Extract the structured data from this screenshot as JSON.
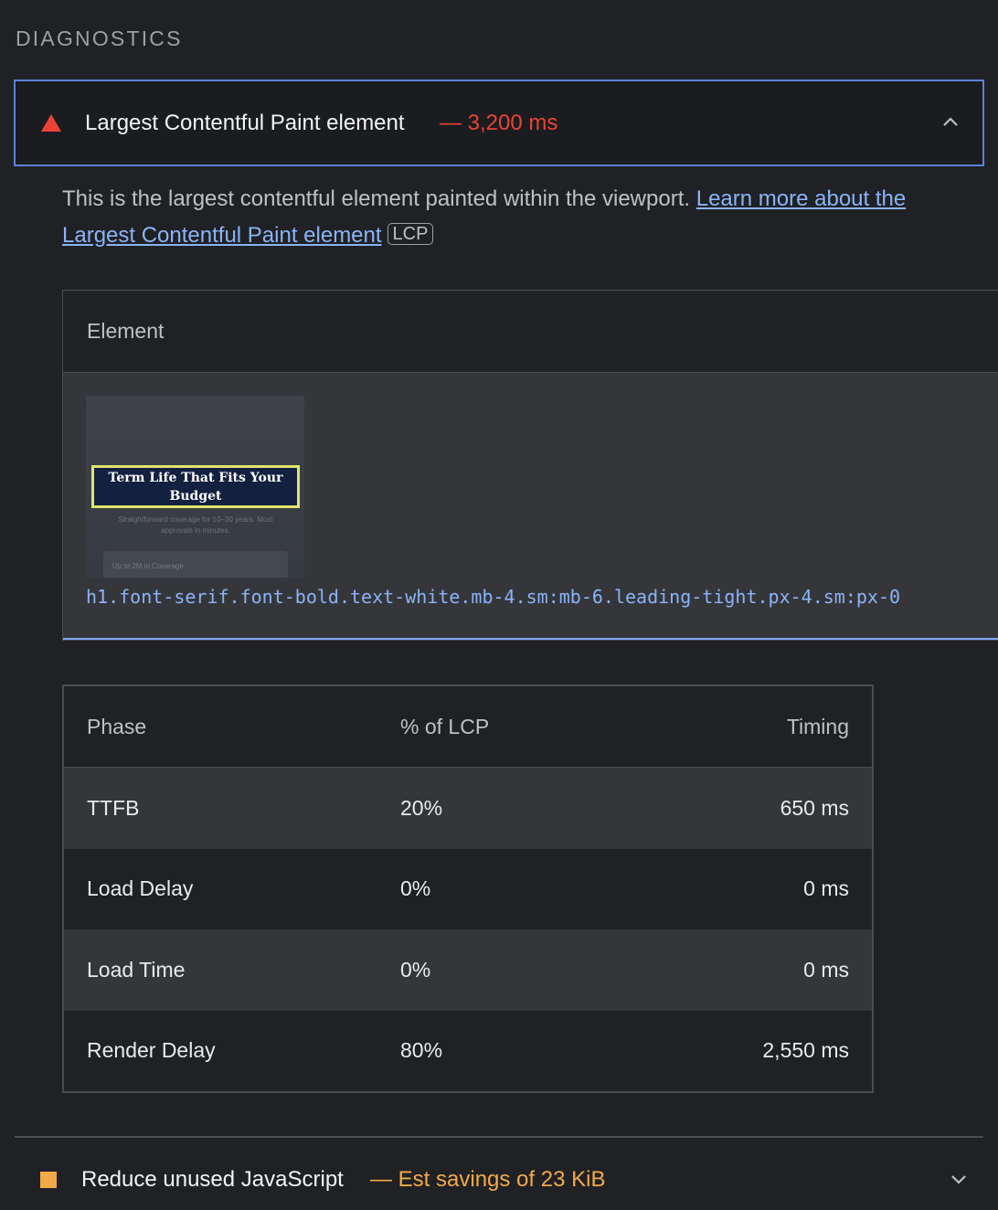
{
  "section": {
    "title": "DIAGNOSTICS"
  },
  "lcp_audit": {
    "title": "Largest Contentful Paint element",
    "metric": "— 3,200 ms",
    "status_color": "#ea4335",
    "status_icon": "red-triangle-icon",
    "expanded": true,
    "description": "This is the largest contentful element painted within the viewport.",
    "learn_more_link": "Learn more about the Largest Contentful Paint element",
    "badge": "LCP",
    "element_table": {
      "header": "Element",
      "thumbnail": {
        "heading": "Term Life That Fits Your Budget",
        "subtext": "Straightforward coverage for 10–30 years. Most approvals in minutes.",
        "pill": "Up to 2M in Coverage"
      },
      "selector": "h1.font-serif.font-bold.text-white.mb-4.sm:mb-6.leading-tight.px-4.sm:px-0"
    },
    "phase_table": {
      "headers": [
        "Phase",
        "% of LCP",
        "Timing"
      ],
      "rows": [
        {
          "phase": "TTFB",
          "percent": "20%",
          "timing": "650 ms"
        },
        {
          "phase": "Load Delay",
          "percent": "0%",
          "timing": "0 ms"
        },
        {
          "phase": "Load Time",
          "percent": "0%",
          "timing": "0 ms"
        },
        {
          "phase": "Render Delay",
          "percent": "80%",
          "timing": "2,550 ms"
        }
      ]
    }
  },
  "js_audit": {
    "title": "Reduce unused JavaScript",
    "metric": "— Est savings of 23 KiB",
    "status_color": "#f2a94a",
    "status_icon": "orange-square-icon",
    "expanded": false
  }
}
